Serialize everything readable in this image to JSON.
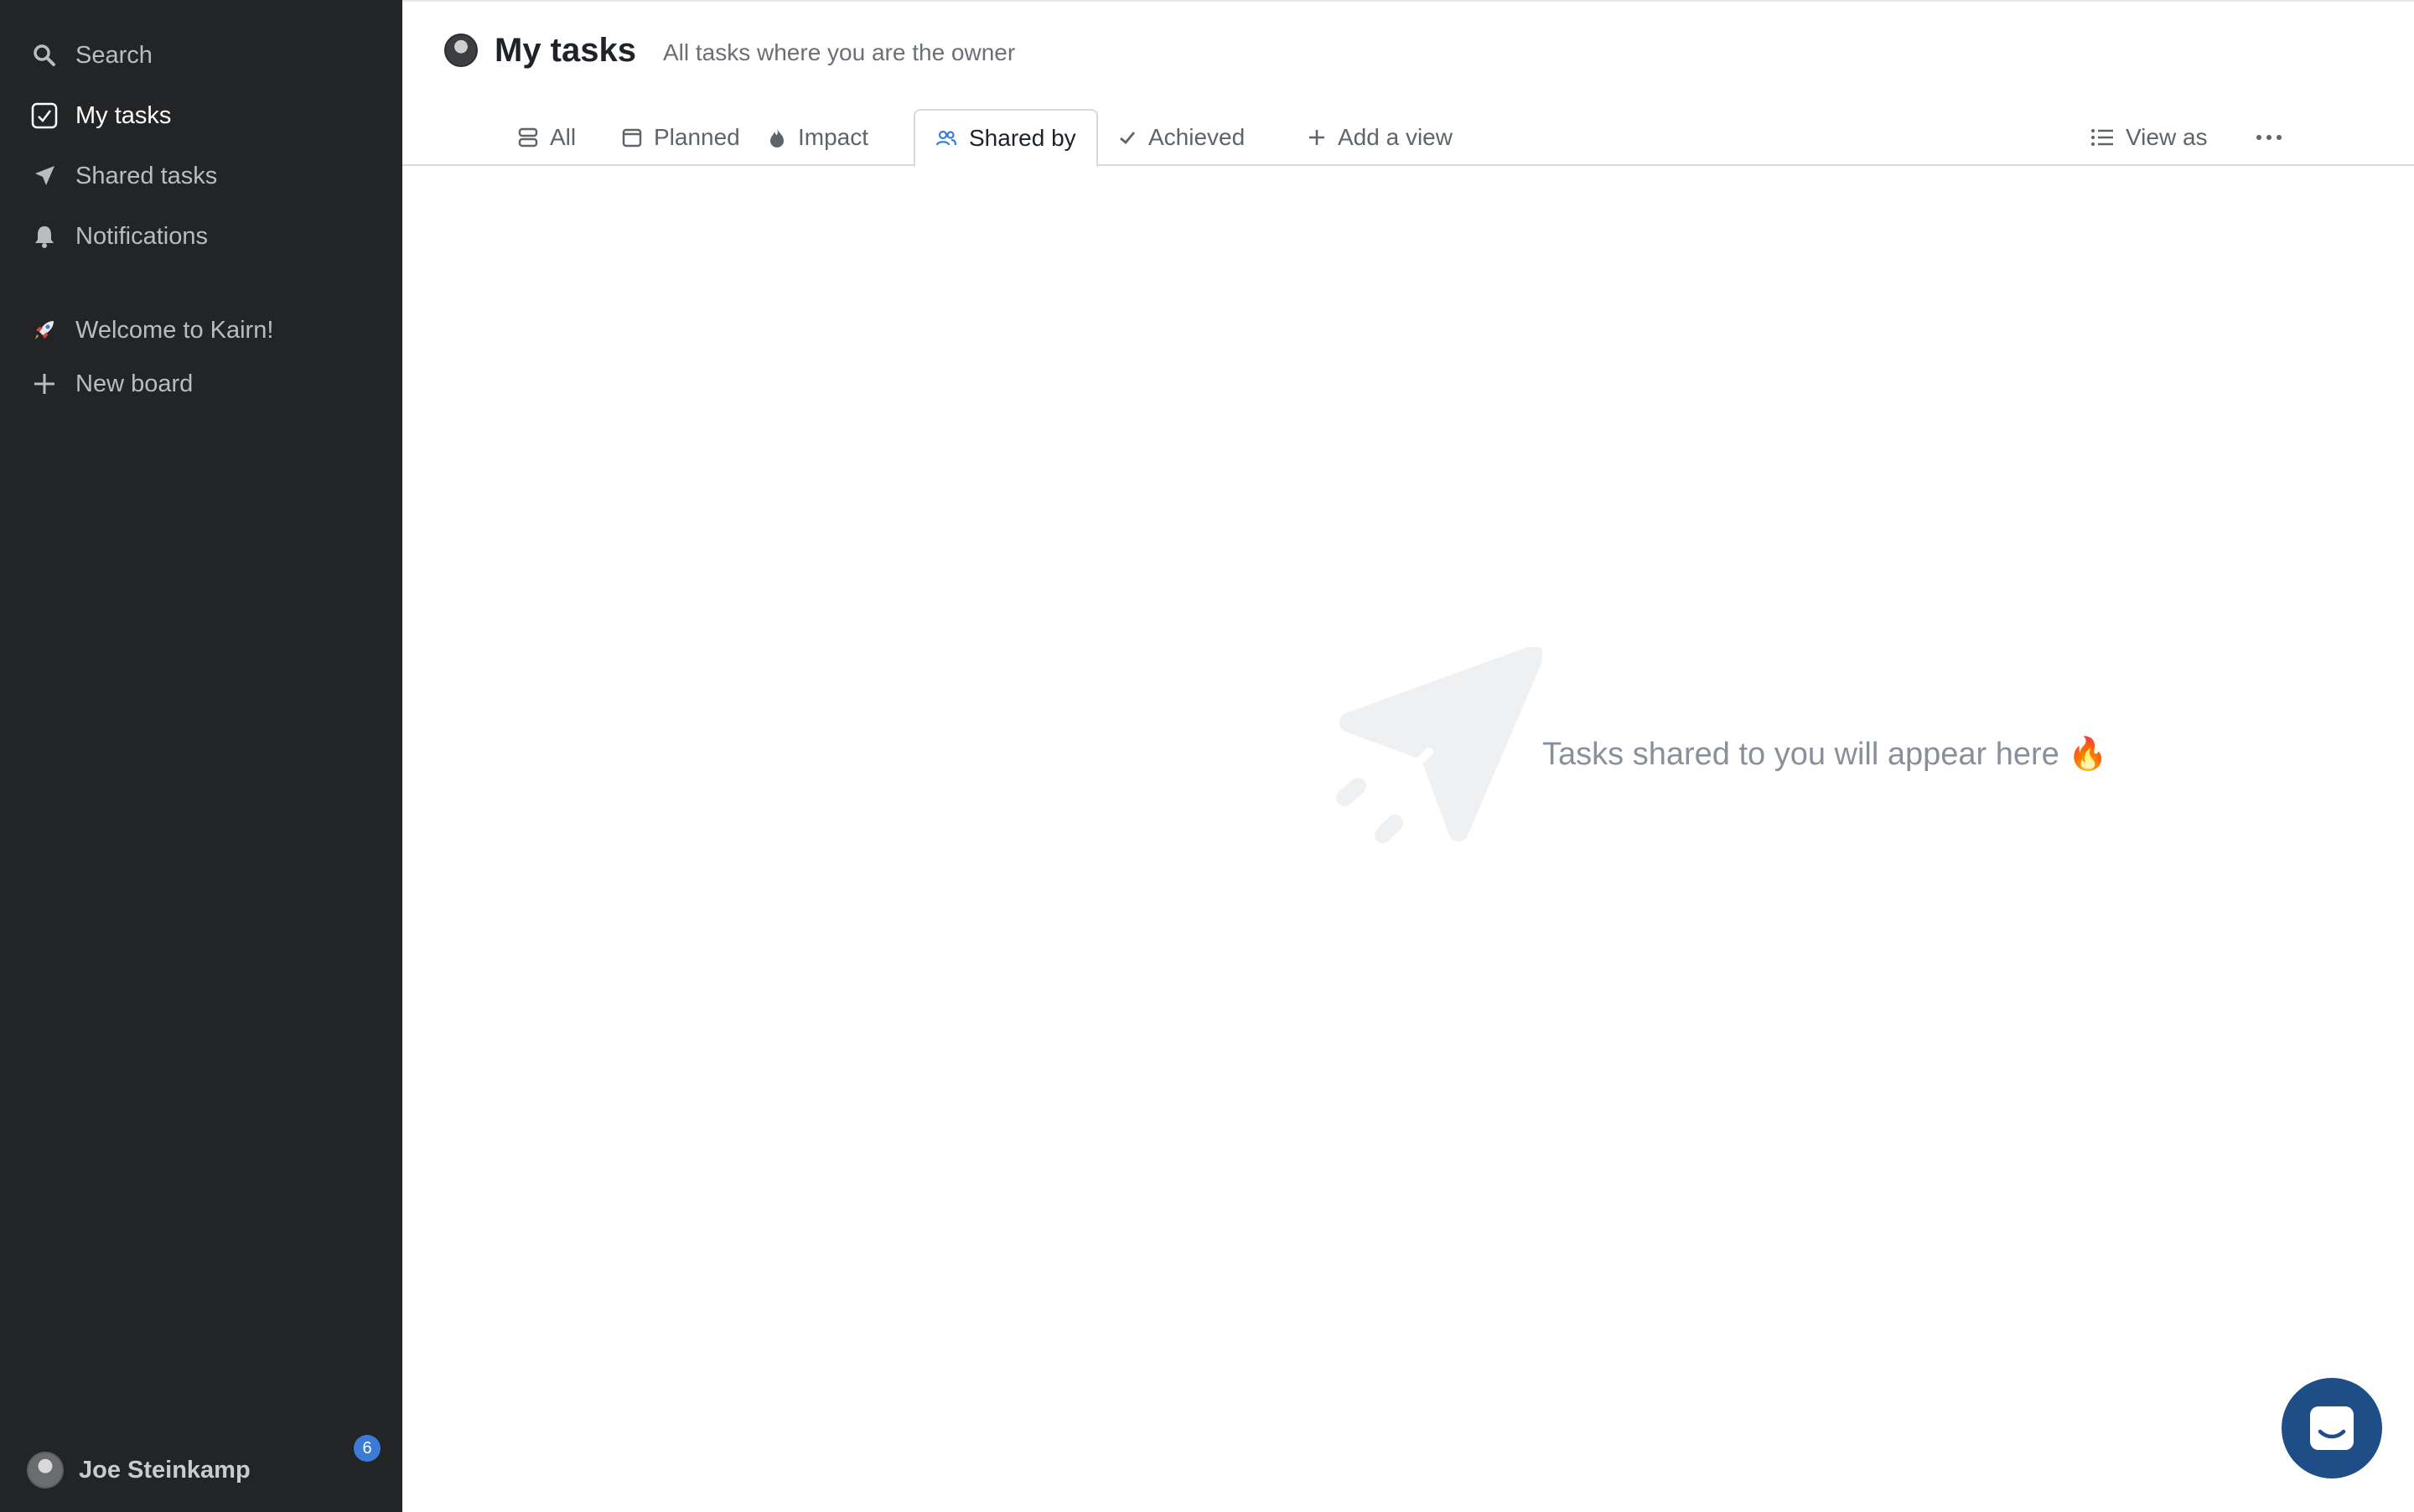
{
  "sidebar": {
    "items": [
      {
        "label": "Search",
        "icon": "search-icon"
      },
      {
        "label": "My tasks",
        "icon": "checkbox-icon"
      },
      {
        "label": "Shared tasks",
        "icon": "paper-plane-icon"
      },
      {
        "label": "Notifications",
        "icon": "bell-icon"
      }
    ],
    "boards": [
      {
        "label": "Welcome to Kairn!",
        "icon": "rocket-icon"
      },
      {
        "label": "New board",
        "icon": "plus-icon"
      }
    ],
    "user": {
      "name": "Joe Steinkamp",
      "badge_count": "6"
    }
  },
  "header": {
    "title": "My tasks",
    "subtitle": "All tasks where you are the owner"
  },
  "tabs": [
    {
      "label": "All",
      "icon": "stack-icon"
    },
    {
      "label": "Planned",
      "icon": "calendar-icon"
    },
    {
      "label": "Impact",
      "icon": "flame-icon"
    },
    {
      "label": "Shared by",
      "icon": "users-icon",
      "active": true
    },
    {
      "label": "Achieved",
      "icon": "check-icon"
    },
    {
      "label": "Add a view",
      "icon": "plus-icon"
    }
  ],
  "toolbar": {
    "view_as_label": "View as"
  },
  "empty_state": {
    "message": "Tasks shared to you will appear here 🔥"
  },
  "colors": {
    "sidebar_bg": "#232426",
    "accent": "#3b7bd6",
    "chat_button": "#1f4e86"
  }
}
